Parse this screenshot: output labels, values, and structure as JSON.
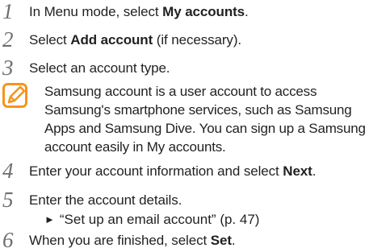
{
  "steps": [
    {
      "number": "1",
      "before": "In Menu mode, select ",
      "bold": "My accounts",
      "after": "."
    },
    {
      "number": "2",
      "before": "Select ",
      "bold": "Add account",
      "after": " (if necessary)."
    },
    {
      "number": "3",
      "before": "Select an account type.",
      "bold": "",
      "after": ""
    },
    {
      "number": "4",
      "before": "Enter your account information and select ",
      "bold": "Next",
      "after": "."
    },
    {
      "number": "5",
      "before": "Enter the account details.",
      "bold": "",
      "after": ""
    },
    {
      "number": "6",
      "before": "When you are finished, select ",
      "bold": "Set",
      "after": "."
    }
  ],
  "note": {
    "icon": "note-pencil-icon",
    "lines": [
      "Samsung account is a user account to access",
      "Samsung's smartphone services, such as Samsung",
      "Apps and Samsung Dive. You can sign up a Samsung",
      "account easily in My accounts."
    ]
  },
  "reference": {
    "arrow": "►",
    "text": "“Set up an email account” (p. 47)"
  },
  "colors": {
    "text": "#231f20",
    "step_number": "#6d6e71",
    "note_icon": "#f7941d"
  }
}
